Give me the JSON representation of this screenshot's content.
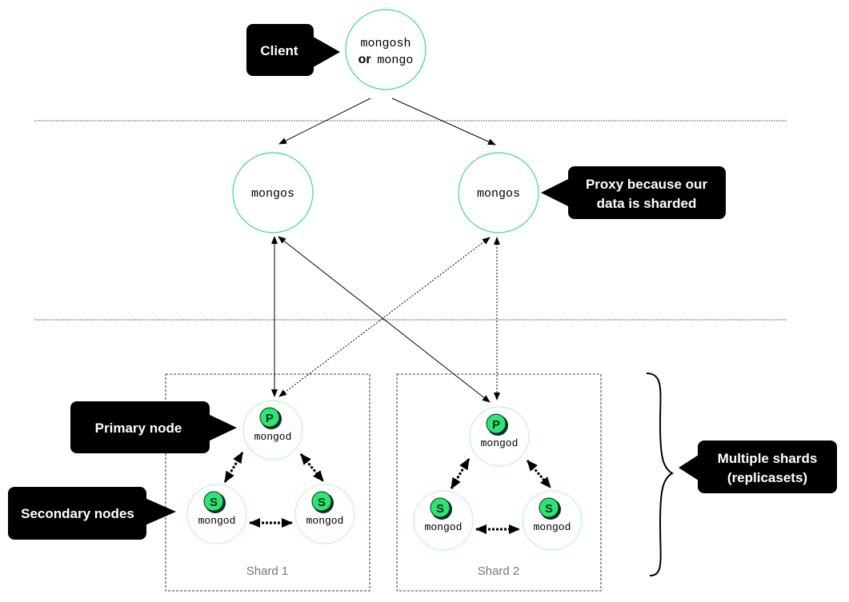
{
  "client": {
    "callout": "Client",
    "line1": "mongosh",
    "or": "or",
    "line2": "mongo"
  },
  "proxies": [
    {
      "label": "mongos"
    },
    {
      "label": "mongos"
    }
  ],
  "proxy_callout": {
    "line1": "Proxy because our",
    "line2": "data is sharded"
  },
  "primary_callout": "Primary node",
  "secondary_callout": "Secondary nodes",
  "shards_callout": {
    "line1": "Multiple shards",
    "line2": "(replicasets)"
  },
  "shards": [
    {
      "label": "Shard 1",
      "primary": {
        "badge": "P",
        "label": "mongod"
      },
      "secondaries": [
        {
          "badge": "S",
          "label": "mongod"
        },
        {
          "badge": "S",
          "label": "mongod"
        }
      ]
    },
    {
      "label": "Shard 2",
      "primary": {
        "badge": "P",
        "label": "mongod"
      },
      "secondaries": [
        {
          "badge": "S",
          "label": "mongod"
        },
        {
          "badge": "S",
          "label": "mongod"
        }
      ]
    }
  ],
  "colors": {
    "node_stroke": "#3ddc84",
    "badge_fill": "#2ee66f",
    "callout": "#000000",
    "shard_label": "#777777"
  }
}
